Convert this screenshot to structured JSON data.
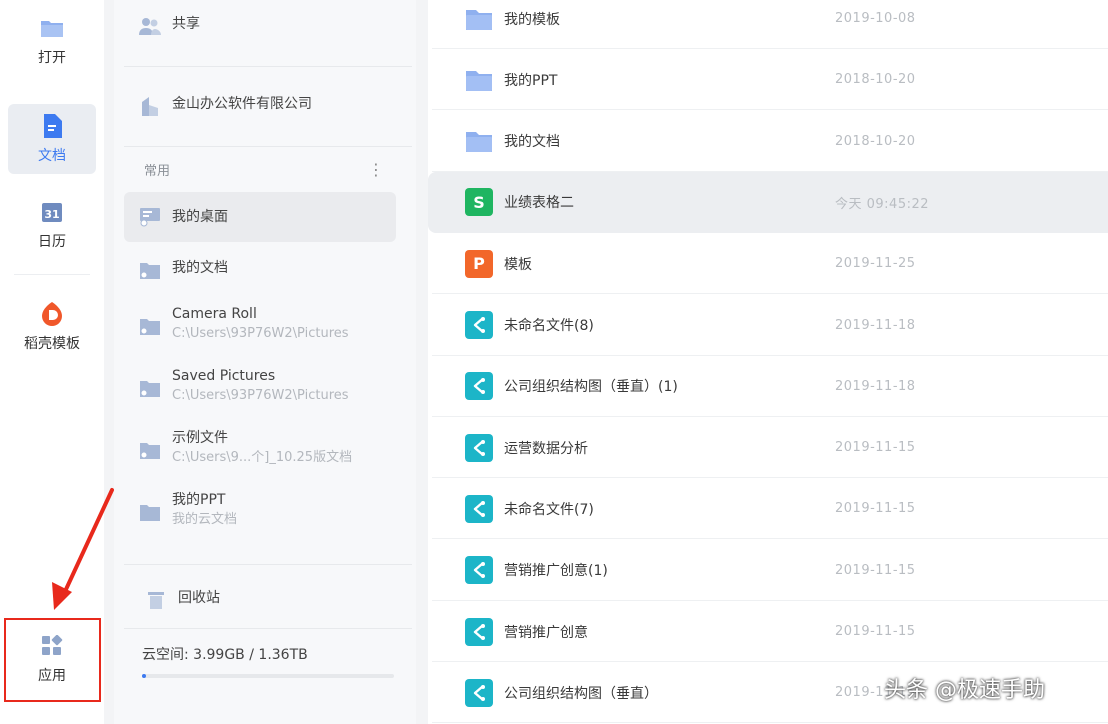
{
  "rail": {
    "items": [
      {
        "label": "打开",
        "icon": "folder-icon"
      },
      {
        "label": "文档",
        "icon": "document-icon"
      },
      {
        "label": "日历",
        "icon": "calendar-icon"
      },
      {
        "label": "稻壳模板",
        "icon": "docer-template-icon"
      },
      {
        "label": "应用",
        "icon": "apps-grid-icon"
      }
    ],
    "active_index": 1
  },
  "middle": {
    "shared_label": "共享",
    "company_label": "金山办公软件有限公司",
    "section_label": "常用",
    "locations": [
      {
        "title": "我的桌面",
        "subtitle": ""
      },
      {
        "title": "我的文档",
        "subtitle": ""
      },
      {
        "title": "Camera Roll",
        "subtitle": "C:\\Users\\93P76W2\\Pictures"
      },
      {
        "title": "Saved Pictures",
        "subtitle": "C:\\Users\\93P76W2\\Pictures"
      },
      {
        "title": "示例文件",
        "subtitle": "C:\\Users\\9...个]_10.25版文档"
      },
      {
        "title": "我的PPT",
        "subtitle": "我的云文档"
      }
    ],
    "trash_label": "回收站",
    "storage_label": "云空间: 3.99GB / 1.36TB",
    "storage_fraction": 0.003
  },
  "files": [
    {
      "name": "我的模板",
      "date": "2019-10-08",
      "type": "folder"
    },
    {
      "name": "我的PPT",
      "date": "2018-10-20",
      "type": "folder"
    },
    {
      "name": "我的文档",
      "date": "2018-10-20",
      "type": "folder"
    },
    {
      "name": "业绩表格二",
      "date": "今天 09:45:22",
      "type": "sheet"
    },
    {
      "name": "模板",
      "date": "2019-11-25",
      "type": "ppt"
    },
    {
      "name": "未命名文件(8)",
      "date": "2019-11-18",
      "type": "mindmap"
    },
    {
      "name": "公司组织结构图（垂直）(1)",
      "date": "2019-11-18",
      "type": "mindmap"
    },
    {
      "name": "运营数据分析",
      "date": "2019-11-15",
      "type": "mindmap"
    },
    {
      "name": "未命名文件(7)",
      "date": "2019-11-15",
      "type": "mindmap"
    },
    {
      "name": "营销推广创意(1)",
      "date": "2019-11-15",
      "type": "mindmap"
    },
    {
      "name": "营销推广创意",
      "date": "2019-11-15",
      "type": "mindmap"
    },
    {
      "name": "公司组织结构图（垂直）",
      "date": "2019-11-15",
      "type": "mindmap"
    }
  ],
  "selected_file_index": 3,
  "watermark": "头条 @极速手助",
  "colors": {
    "accent": "#3d7af0",
    "folder": "#8fb0ef",
    "sheet": "#1fb561",
    "ppt": "#f2672a",
    "mindmap": "#1cb5c8",
    "annotation": "#e8291c"
  }
}
